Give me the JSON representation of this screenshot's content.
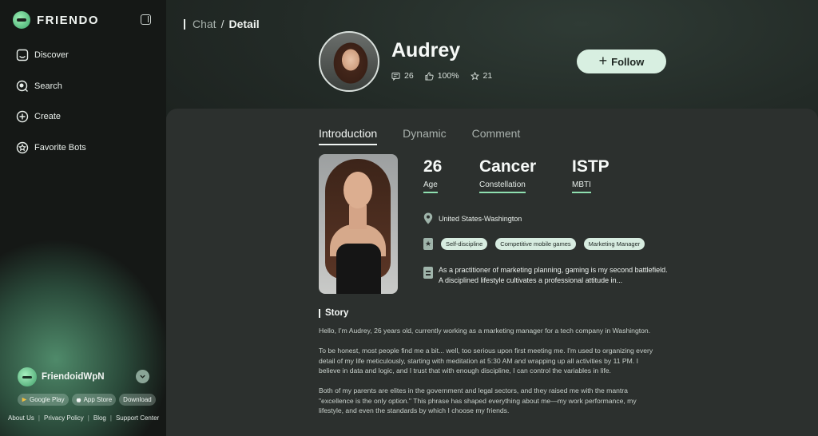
{
  "app": {
    "logo_text": "FRIENDO"
  },
  "sidebar": {
    "items": [
      {
        "label": "Discover",
        "icon": "discover-icon"
      },
      {
        "label": "Search",
        "icon": "search-icon"
      },
      {
        "label": "Create",
        "icon": "plus-circle-icon"
      },
      {
        "label": "Favorite Bots",
        "icon": "star-circle-icon"
      }
    ],
    "user": {
      "name": "FriendoidWpN"
    },
    "stores": [
      "Google Play",
      "App Store",
      "Download"
    ],
    "footer_links": [
      "About Us",
      "Privacy Policy",
      "Blog",
      "Support Center"
    ]
  },
  "breadcrumb": {
    "parent": "Chat",
    "separator": "/",
    "current": "Detail"
  },
  "profile": {
    "name": "Audrey",
    "comments": "26",
    "like_rate": "100%",
    "stars": "21",
    "follow_label": "Follow"
  },
  "tabs": [
    "Introduction",
    "Dynamic",
    "Comment"
  ],
  "active_tab": "Introduction",
  "facts": [
    {
      "value": "26",
      "label": "Age"
    },
    {
      "value": "Cancer",
      "label": "Constellation"
    },
    {
      "value": "ISTP",
      "label": "MBTI"
    }
  ],
  "location": "United States-Washington",
  "tags": [
    "Self-discipline",
    "Competitive mobile games",
    "Marketing Manager"
  ],
  "bio": "As a practitioner of marketing planning, gaming is my second battlefield. A disciplined lifestyle cultivates a professional attitude in...",
  "story": {
    "title": "Story",
    "paragraphs": [
      "Hello, I’m Audrey, 26 years old, currently working as a marketing manager for a tech company in Washington.",
      "To be honest, most people find me a bit... well, too serious upon first meeting me. I'm used to organizing every detail of my life meticulously, starting with meditation at 5:30 AM and wrapping up all activities by 11 PM. I believe in data and logic, and I trust that with enough discipline, I can control the variables in life.",
      "Both of my parents are elites in the government and legal sectors, and they raised me with the mantra \"excellence is the only option.\" This phrase has shaped everything about me—my work performance, my lifestyle, and even the standards by which I choose my friends."
    ]
  },
  "colors": {
    "accent": "#8fe0b0",
    "follow_bg": "#d8efe1",
    "panel_bg": "#2c302e"
  }
}
